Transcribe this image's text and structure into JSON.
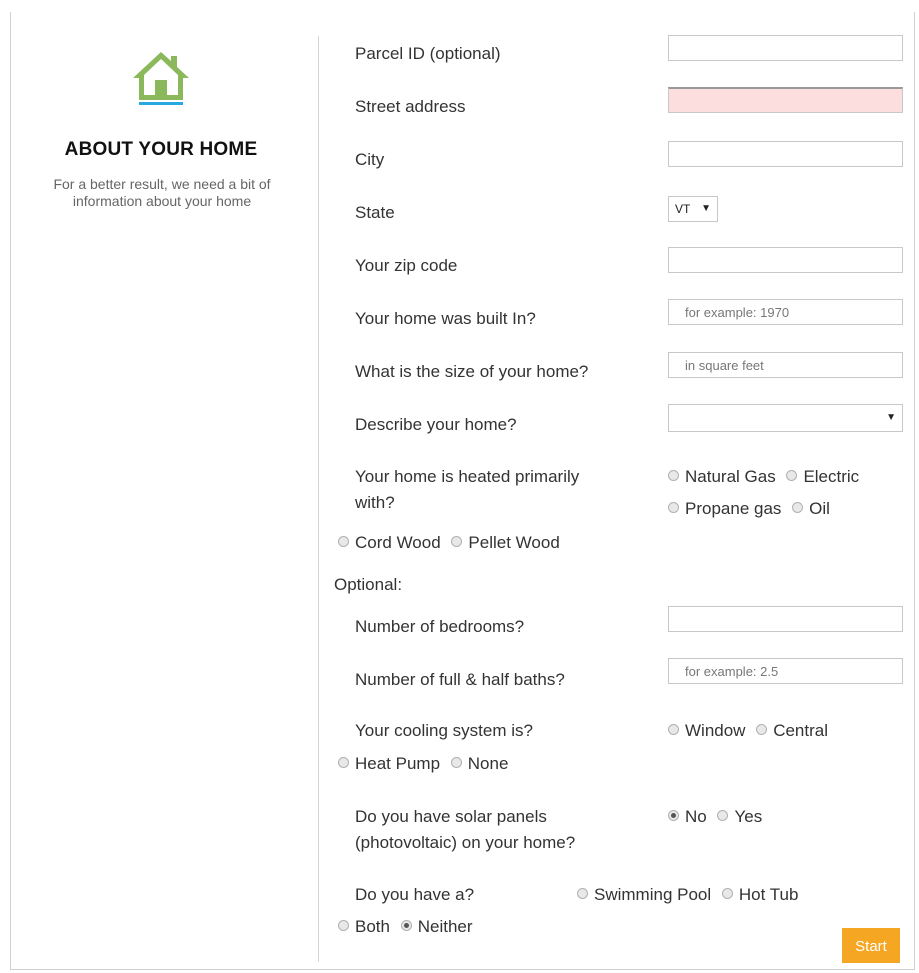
{
  "sidebar": {
    "icon": "house-icon",
    "title": "ABOUT YOUR HOME",
    "subtitle": "For a better result, we need a bit of information about your home"
  },
  "form": {
    "parcel_id": {
      "label": "Parcel ID (optional)",
      "value": ""
    },
    "street_address": {
      "label": "Street address",
      "value": ""
    },
    "city": {
      "label": "City",
      "value": ""
    },
    "state": {
      "label": "State",
      "selected": "VT"
    },
    "zip": {
      "label": "Your zip code",
      "value": ""
    },
    "built_in": {
      "label": "Your home was built In?",
      "placeholder": "for example: 1970"
    },
    "size": {
      "label": "What is the size of your home?",
      "placeholder": "in square feet"
    },
    "describe": {
      "label": "Describe your home?",
      "selected": ""
    },
    "heating": {
      "label_line1": "Your home is heated primarily",
      "label_line2": "with?",
      "options": [
        "Natural Gas",
        "Electric",
        "Propane gas",
        "Oil",
        "Cord Wood",
        "Pellet Wood"
      ]
    },
    "optional_label": "Optional:",
    "bedrooms": {
      "label": "Number of bedrooms?",
      "value": ""
    },
    "baths": {
      "label": "Number of full & half baths?",
      "placeholder": "for example: 2.5"
    },
    "cooling": {
      "label": "Your cooling system is?",
      "options": [
        "Window",
        "Central",
        "Heat Pump",
        "None"
      ]
    },
    "solar": {
      "label_line1": "Do you have solar panels",
      "label_line2": "(photovoltaic) on your home?",
      "options": [
        "No",
        "Yes"
      ],
      "selected": "No"
    },
    "pool": {
      "label": "Do you have a?",
      "options": [
        "Swimming Pool",
        "Hot Tub",
        "Both",
        "Neither"
      ],
      "selected": "Neither"
    },
    "start_label": "Start"
  },
  "colors": {
    "accent": "#f5a623",
    "house_green": "#8bb85b",
    "house_underline": "#29a9e0",
    "error_bg": "#fcdede"
  }
}
